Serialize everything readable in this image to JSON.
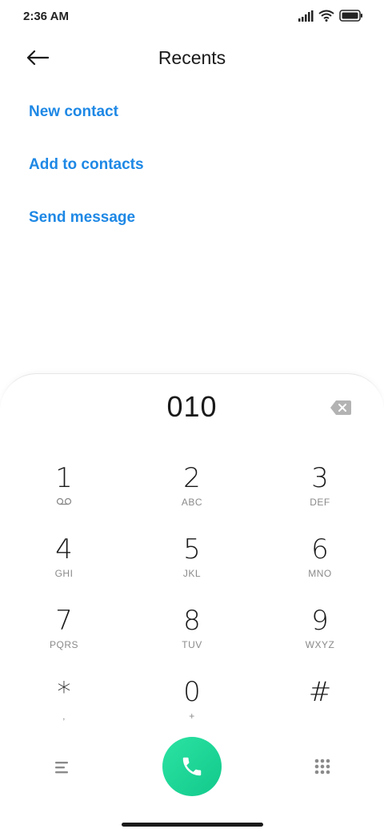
{
  "status_bar": {
    "time": "2:36 AM",
    "icons": [
      "signal-icon",
      "wifi-icon",
      "battery-icon"
    ]
  },
  "header": {
    "title": "Recents",
    "back_icon": "arrow-left-icon"
  },
  "actions": [
    {
      "label": "New contact"
    },
    {
      "label": "Add to contacts"
    },
    {
      "label": "Send message"
    }
  ],
  "dialpad": {
    "number": "010",
    "backspace_icon": "backspace-icon",
    "keys": [
      {
        "digit": "1",
        "letters": ""
      },
      {
        "digit": "2",
        "letters": "ABC"
      },
      {
        "digit": "3",
        "letters": "DEF"
      },
      {
        "digit": "4",
        "letters": "GHI"
      },
      {
        "digit": "5",
        "letters": "JKL"
      },
      {
        "digit": "6",
        "letters": "MNO"
      },
      {
        "digit": "7",
        "letters": "PQRS"
      },
      {
        "digit": "8",
        "letters": "TUV"
      },
      {
        "digit": "9",
        "letters": "WXYZ"
      },
      {
        "digit": "*",
        "letters": ","
      },
      {
        "digit": "0",
        "letters": "+"
      },
      {
        "digit": "#",
        "letters": ""
      }
    ],
    "voicemail_icon": "voicemail-icon"
  },
  "bottom_bar": {
    "menu_icon": "menu-icon",
    "call_icon": "phone-icon",
    "dialpad_icon": "dialpad-grid-icon"
  },
  "colors": {
    "accent": "#1e88e5",
    "call_green": "#19d293",
    "text": "#1a1a1a",
    "secondary": "#8a8a8a"
  }
}
